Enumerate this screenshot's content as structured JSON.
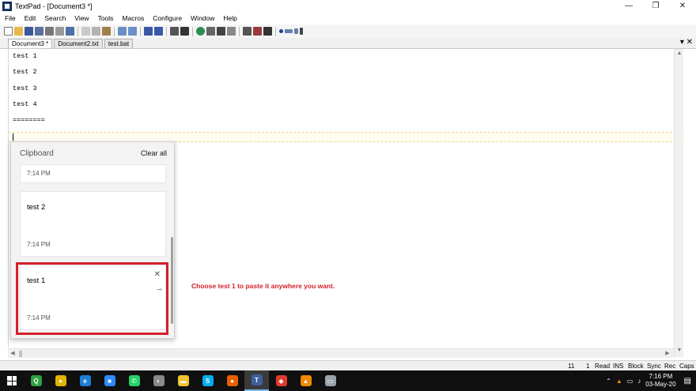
{
  "window": {
    "title": "TextPad - [Document3 *]",
    "controls": {
      "minimize": "—",
      "restore": "❐",
      "close": "✕"
    }
  },
  "menu": [
    "File",
    "Edit",
    "Search",
    "View",
    "Tools",
    "Macros",
    "Configure",
    "Window",
    "Help"
  ],
  "tabs": [
    {
      "label": "Document3 *",
      "active": true
    },
    {
      "label": "Document2.txt",
      "active": false
    },
    {
      "label": "test.bat",
      "active": false
    }
  ],
  "tab_close": "▾ ✕",
  "editor": {
    "lines": [
      "test 1",
      "test 2",
      "test 3",
      "test 4",
      "========"
    ]
  },
  "clipboard": {
    "title": "Clipboard",
    "clear_all": "Clear all",
    "items": [
      {
        "text": "",
        "time": "7:14 PM"
      },
      {
        "text": "test 2",
        "time": "7:14 PM"
      },
      {
        "text": "test 1",
        "time": "7:14 PM"
      }
    ],
    "close_glyph": "✕",
    "pin_glyph": "⊸"
  },
  "annotation": "Choose test 1 to paste it anywhere you want.",
  "statusbar": {
    "line": "11",
    "col": "1",
    "mode": "Read",
    "ins": "INS",
    "block": "Block",
    "sync": "Sync",
    "rec": "Rec",
    "caps": "Caps"
  },
  "taskbar": {
    "apps": [
      {
        "icon": "shield-app-icon",
        "color": "#2ea043",
        "glyph": "Q"
      },
      {
        "icon": "chrome-icon",
        "color": "#e2b400",
        "glyph": "●"
      },
      {
        "icon": "edge-icon",
        "color": "#1e7fd6",
        "glyph": "e"
      },
      {
        "icon": "zoom-icon",
        "color": "#2d8cff",
        "glyph": "■"
      },
      {
        "icon": "whatsapp-icon",
        "color": "#25d366",
        "glyph": "✆"
      },
      {
        "icon": "app-gray-icon",
        "color": "#8a8a8a",
        "glyph": "◐"
      },
      {
        "icon": "folder-icon",
        "color": "#f2c230",
        "glyph": "▬"
      },
      {
        "icon": "skype-icon",
        "color": "#00aff0",
        "glyph": "S"
      },
      {
        "icon": "firefox-icon",
        "color": "#e66000",
        "glyph": "●"
      },
      {
        "icon": "textpad-icon",
        "color": "#3f5f9e",
        "glyph": "T"
      },
      {
        "icon": "anydesk-icon",
        "color": "#e03a2f",
        "glyph": "◆"
      },
      {
        "icon": "vlc-icon",
        "color": "#f08a00",
        "glyph": "▲"
      },
      {
        "icon": "app-laptop-icon",
        "color": "#9aa3ad",
        "glyph": "▭"
      }
    ],
    "tray_glyphs": [
      "⌃",
      "▲",
      "▭",
      "♪",
      "ENG"
    ],
    "time": "7:16 PM",
    "date": "03-May-20",
    "notification_glyph": "▤"
  },
  "colors": {
    "accent_red": "#d5202a",
    "taskbar": "#101010"
  }
}
